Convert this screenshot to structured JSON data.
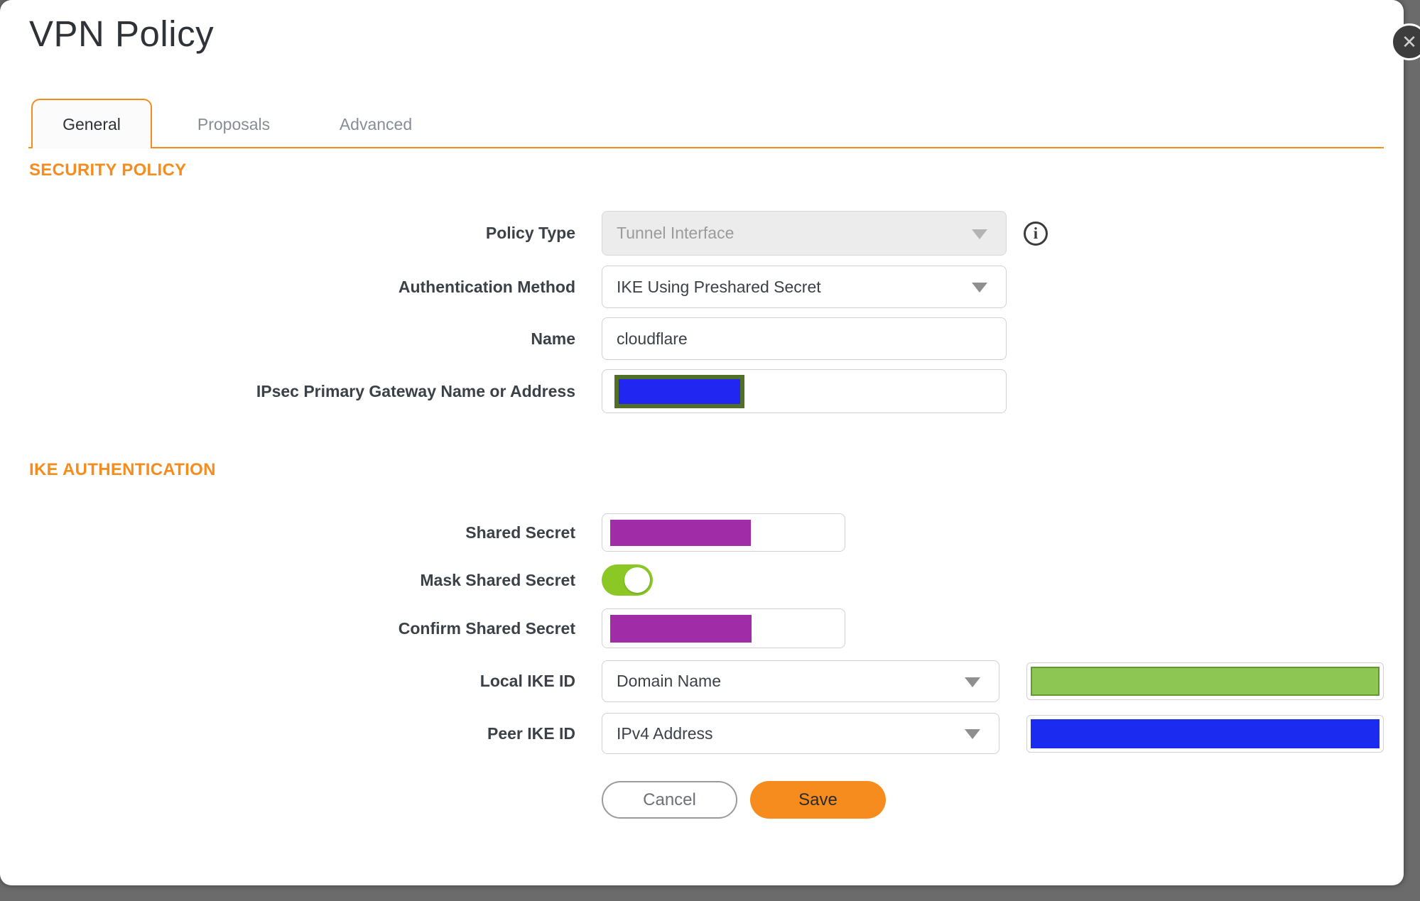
{
  "dialog": {
    "title": "VPN Policy",
    "close_icon": "✕",
    "backdrop_color": "#6b6b6b",
    "accent_color": "#f78c1e"
  },
  "tabs": [
    {
      "label": "General",
      "active": true
    },
    {
      "label": "Proposals",
      "active": false
    },
    {
      "label": "Advanced",
      "active": false
    }
  ],
  "security_policy": {
    "heading": "SECURITY POLICY",
    "policy_type": {
      "label": "Policy Type",
      "value": "Tunnel Interface",
      "disabled": true,
      "info_icon": "i"
    },
    "auth_method": {
      "label": "Authentication Method",
      "value": "IKE Using Preshared Secret"
    },
    "name": {
      "label": "Name",
      "value": "cloudflare"
    },
    "gateway": {
      "label": "IPsec Primary Gateway Name or Address",
      "redaction": {
        "fill": "#2127f1",
        "border": "#4f7026"
      }
    }
  },
  "ike_authentication": {
    "heading": "IKE AUTHENTICATION",
    "shared_secret": {
      "label": "Shared Secret",
      "redaction": {
        "fill": "#a02ca8"
      }
    },
    "mask_shared_secret": {
      "label": "Mask Shared Secret",
      "state": "on",
      "toggle_color": "#8bc725"
    },
    "confirm_shared_secret": {
      "label": "Confirm Shared Secret",
      "redaction": {
        "fill": "#a02ca8"
      }
    },
    "local_ike_id": {
      "label": "Local IKE ID",
      "type_value": "Domain Name",
      "redaction": {
        "fill": "#8dc653",
        "border": "#5f9a31"
      }
    },
    "peer_ike_id": {
      "label": "Peer IKE ID",
      "type_value": "IPv4 Address",
      "redaction": {
        "fill": "#1b2cf0"
      }
    }
  },
  "buttons": {
    "cancel": "Cancel",
    "save": "Save"
  }
}
